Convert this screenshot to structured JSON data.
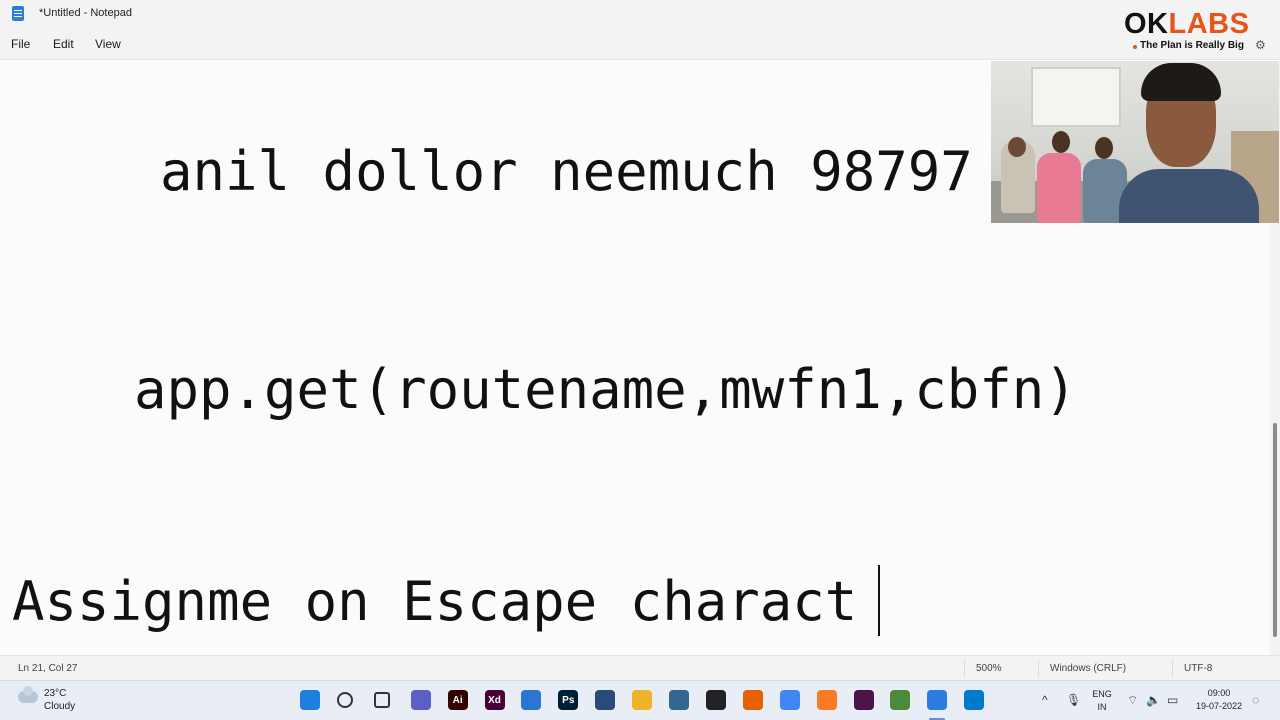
{
  "window": {
    "title": "*Untitled - Notepad",
    "app_icon": "notepad-icon"
  },
  "menu": {
    "file": "File",
    "edit": "Edit",
    "view": "View"
  },
  "brand": {
    "logo_ok": "OK",
    "logo_labs": "LABS",
    "tagline": "The Plan is Really Big",
    "accent_color": "#e8541a"
  },
  "editor": {
    "lines": [
      "anil dollor neemuch 98797",
      "app.get(routename,mwfn1,cbfn)",
      "Assignme on Escape charact"
    ]
  },
  "status": {
    "position": "Ln 21, Col 27",
    "zoom": "500%",
    "line_ending": "Windows (CRLF)",
    "encoding": "UTF-8"
  },
  "taskbar": {
    "weather_temp": "23°C",
    "weather_desc": "Cloudy",
    "apps": [
      {
        "name": "start-icon",
        "label": "",
        "color": "#1f7fe0"
      },
      {
        "name": "search-icon",
        "label": "",
        "color": "#333333"
      },
      {
        "name": "task-view-icon",
        "label": "",
        "color": "#333333"
      },
      {
        "name": "teams-chat-icon",
        "label": "",
        "color": "#5b5fc7"
      },
      {
        "name": "illustrator-icon",
        "label": "Ai",
        "color": "#330000"
      },
      {
        "name": "xd-icon",
        "label": "Xd",
        "color": "#470137"
      },
      {
        "name": "snipping-tool-icon",
        "label": "",
        "color": "#2a76d2"
      },
      {
        "name": "photoshop-icon",
        "label": "Ps",
        "color": "#001e36"
      },
      {
        "name": "virtualbox-icon",
        "label": "",
        "color": "#2a4a7a"
      },
      {
        "name": "file-explorer-icon",
        "label": "",
        "color": "#f0b429"
      },
      {
        "name": "postgresql-icon",
        "label": "",
        "color": "#336791"
      },
      {
        "name": "obs-icon",
        "label": "",
        "color": "#222222"
      },
      {
        "name": "firefox-icon",
        "label": "",
        "color": "#e66000"
      },
      {
        "name": "chrome-icon",
        "label": "",
        "color": "#4285f4"
      },
      {
        "name": "xampp-icon",
        "label": "",
        "color": "#fb7a24"
      },
      {
        "name": "slack-icon",
        "label": "",
        "color": "#4a154b"
      },
      {
        "name": "chrome-dev-icon",
        "label": "",
        "color": "#4b8b3b"
      },
      {
        "name": "notepad-taskbar-icon",
        "label": "",
        "color": "#2b7de0"
      },
      {
        "name": "vscode-icon",
        "label": "",
        "color": "#007acc"
      }
    ],
    "language": "ENG",
    "region": "IN",
    "time": "09:00",
    "date": "19-07-2022"
  }
}
